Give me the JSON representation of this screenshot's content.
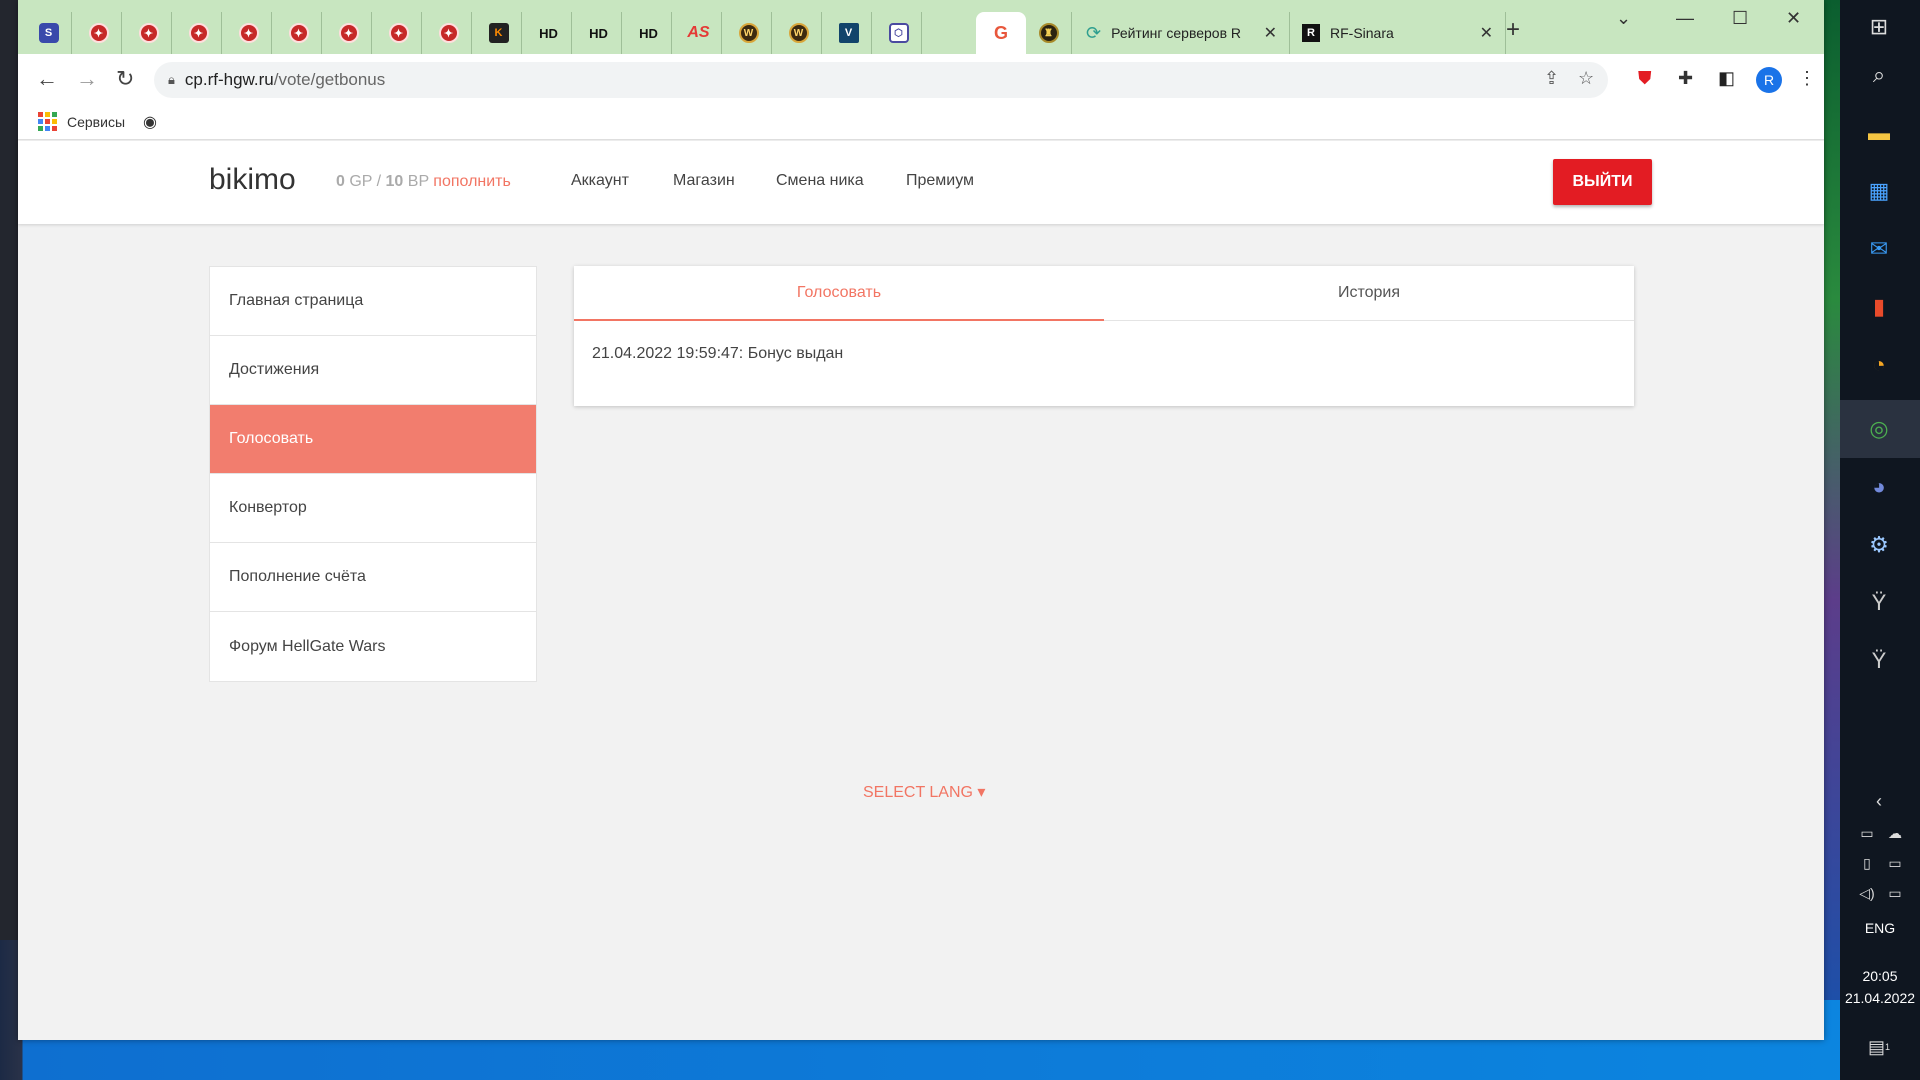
{
  "browser": {
    "tabs_mini": [
      {
        "icon": "site-s-icon",
        "glyph": "S",
        "style": "blue"
      },
      {
        "icon": "red-badge-icon",
        "glyph": "✦",
        "style": "red"
      },
      {
        "icon": "red-badge-icon",
        "glyph": "✦",
        "style": "red"
      },
      {
        "icon": "red-badge-icon",
        "glyph": "✦",
        "style": "red"
      },
      {
        "icon": "red-badge-icon",
        "glyph": "✦",
        "style": "red"
      },
      {
        "icon": "red-badge-icon",
        "glyph": "✦",
        "style": "red"
      },
      {
        "icon": "red-badge-icon",
        "glyph": "✦",
        "style": "red"
      },
      {
        "icon": "red-badge-icon",
        "glyph": "✦",
        "style": "red"
      },
      {
        "icon": "red-badge-icon",
        "glyph": "✦",
        "style": "red"
      },
      {
        "icon": "k-logo-icon",
        "glyph": "K",
        "style": "dark"
      },
      {
        "icon": "hd-text-icon",
        "glyph": "HD",
        "style": "hd"
      },
      {
        "icon": "hd-text-icon",
        "glyph": "HD",
        "style": "hd"
      },
      {
        "icon": "hd-text-icon",
        "glyph": "HD",
        "style": "hd"
      },
      {
        "icon": "as-logo-icon",
        "glyph": "AS",
        "style": "as"
      },
      {
        "icon": "wow-logo-icon",
        "glyph": "W",
        "style": "wow"
      },
      {
        "icon": "wow-logo-icon",
        "glyph": "W",
        "style": "wow"
      },
      {
        "icon": "v-logo-icon",
        "glyph": "V",
        "style": "v"
      },
      {
        "icon": "hexagon-icon",
        "glyph": "⬡",
        "style": "hex"
      }
    ],
    "active_tab_icon": {
      "glyph": "G",
      "style": "g"
    },
    "after_active_icon": {
      "glyph": "♜",
      "style": "horn"
    },
    "tabs_wide": [
      {
        "title": "Рейтинг серверов R",
        "icon_glyph": "⟳"
      },
      {
        "title": "RF-Sinara",
        "icon_glyph": "R"
      }
    ],
    "new_tab": "+",
    "url_host": "cp.rf-hgw.ru",
    "url_path": "/vote/getbonus",
    "profile_initial": "R",
    "bookmarks": [
      {
        "label": "Сервисы"
      }
    ]
  },
  "site": {
    "brand": "bikimo",
    "balance_gp": "0",
    "gp_label": "GP /",
    "balance_bp": "10",
    "bp_label": "BP",
    "topup": "пополнить",
    "nav": [
      "Аккаунт",
      "Магазин",
      "Смена ника",
      "Премиум"
    ],
    "logout": "ВЫЙТИ"
  },
  "sidebar": {
    "items": [
      {
        "label": "Главная страница",
        "active": false
      },
      {
        "label": "Достижения",
        "active": false
      },
      {
        "label": "Голосовать",
        "active": true
      },
      {
        "label": "Конвертор",
        "active": false
      },
      {
        "label": "Пополнение счёта",
        "active": false
      },
      {
        "label": "Форум HellGate Wars",
        "active": false
      }
    ]
  },
  "panel": {
    "tabs": [
      "Голосовать",
      "История"
    ],
    "active_tab": 0,
    "log": "21.04.2022 19:59:47: Бонус выдан"
  },
  "footer": {
    "select_lang": "SELECT LANG ▾"
  },
  "taskbar": {
    "lang": "ENG",
    "time": "20:05",
    "date": "21.04.2022",
    "notifications": "1"
  },
  "colors": {
    "accent": "#f27563",
    "logout": "#e31c23",
    "sidebar_active": "#f27d6e"
  }
}
